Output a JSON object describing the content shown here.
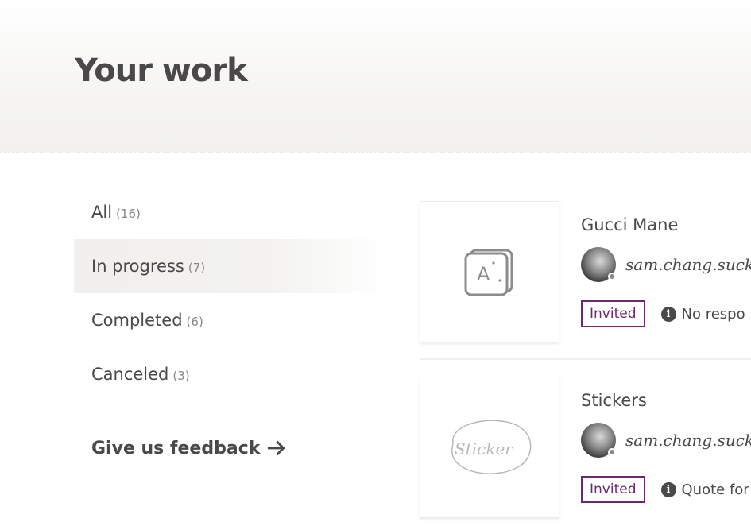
{
  "header": {
    "title": "Your work"
  },
  "filters": [
    {
      "label": "All",
      "count": "(16)"
    },
    {
      "label": "In progress",
      "count": "(7)"
    },
    {
      "label": "Completed",
      "count": "(6)"
    },
    {
      "label": "Canceled",
      "count": "(3)"
    }
  ],
  "active_filter": "In progress",
  "feedback": {
    "label": "Give us feedback"
  },
  "cards": [
    {
      "title": "Gucci Mane",
      "username": "sam.chang.suck",
      "badge": "Invited",
      "info": "No respo",
      "thumbnail_icon": "app-icon"
    },
    {
      "title": "Stickers",
      "username": "sam.chang.suck",
      "badge": "Invited",
      "info": "Quote for",
      "thumbnail_icon": "sticker-sketch-icon",
      "thumbnail_text": "Sticker"
    }
  ],
  "colors": {
    "accent": "#6b2a6e",
    "text": "#4a4848",
    "muted": "#8a8785"
  }
}
